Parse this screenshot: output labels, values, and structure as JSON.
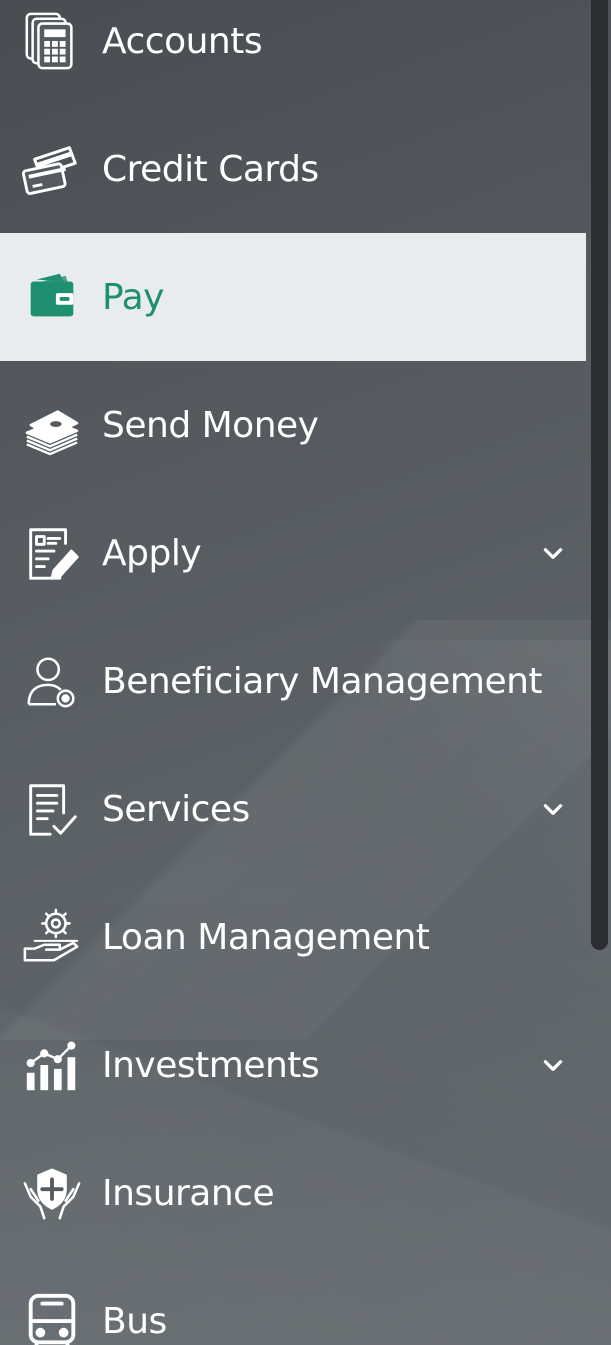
{
  "colors": {
    "background": "#555b60",
    "active_background": "#e8ecee",
    "active_accent": "#1f8f72",
    "text": "#ffffff",
    "scrollbar_thumb": "#2b2f33"
  },
  "menu": {
    "items": [
      {
        "label": "Accounts",
        "icon": "accounts-calculator-icon",
        "active": false,
        "expandable": false
      },
      {
        "label": "Credit Cards",
        "icon": "credit-cards-icon",
        "active": false,
        "expandable": false
      },
      {
        "label": "Pay",
        "icon": "wallet-icon",
        "active": true,
        "expandable": false
      },
      {
        "label": "Send Money",
        "icon": "money-stack-icon",
        "active": false,
        "expandable": false
      },
      {
        "label": "Apply",
        "icon": "form-edit-icon",
        "active": false,
        "expandable": true
      },
      {
        "label": "Beneficiary Management",
        "icon": "user-settings-icon",
        "active": false,
        "expandable": false
      },
      {
        "label": "Services",
        "icon": "document-check-icon",
        "active": false,
        "expandable": true
      },
      {
        "label": "Loan Management",
        "icon": "hand-gear-icon",
        "active": false,
        "expandable": false
      },
      {
        "label": "Investments",
        "icon": "growth-chart-icon",
        "active": false,
        "expandable": true
      },
      {
        "label": "Insurance",
        "icon": "shield-hands-icon",
        "active": false,
        "expandable": false
      },
      {
        "label": "Bus",
        "icon": "bus-icon",
        "active": false,
        "expandable": false
      }
    ]
  }
}
